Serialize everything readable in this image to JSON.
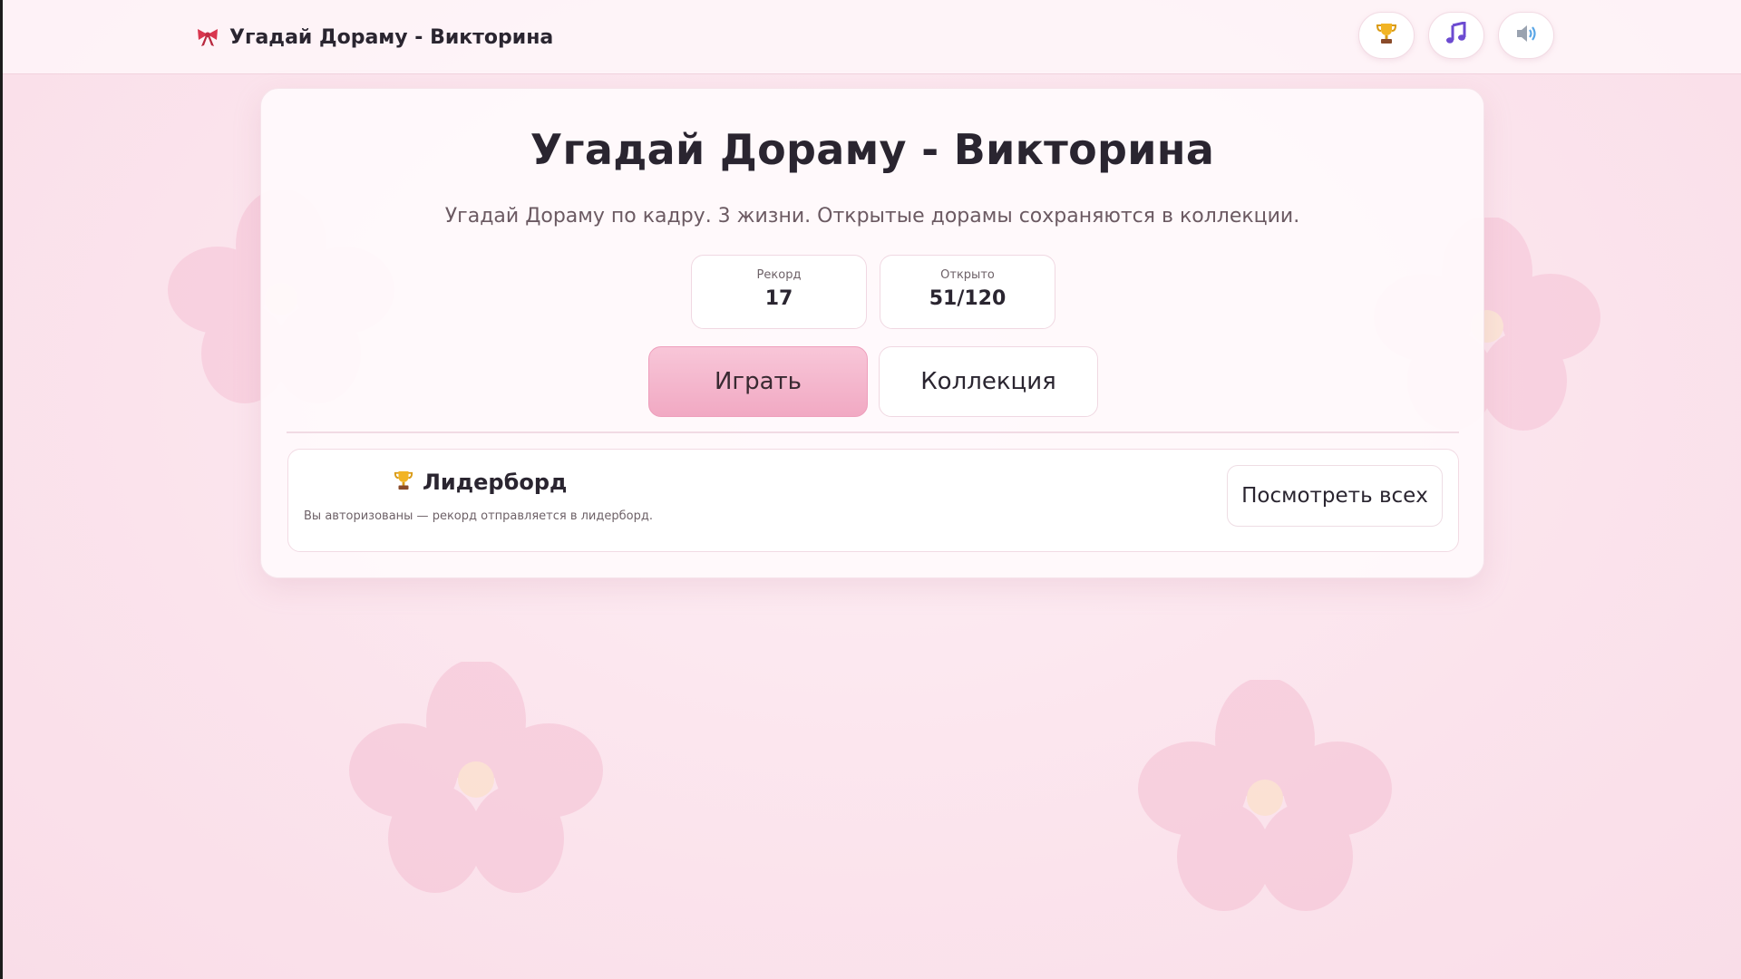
{
  "header": {
    "brand_title": "Угадай Дораму - Викторина",
    "icons": [
      "bow-icon",
      "trophy-icon",
      "music-note-icon",
      "speaker-icon"
    ]
  },
  "main": {
    "title": "Угадай Дораму - Викторина",
    "subtitle": "Угадай Дораму по кадру. 3 жизни. Открытые дорамы сохраняются в коллекции.",
    "stats": [
      {
        "label": "Рекорд",
        "value": "17"
      },
      {
        "label": "Открыто",
        "value": "51/120"
      }
    ],
    "buttons": {
      "play": "Играть",
      "collection": "Коллекция"
    },
    "leaderboard": {
      "title": "Лидерборд",
      "note": "Вы авторизованы — рекорд отправляется в лидерборд.",
      "view_all": "Посмотреть всех"
    }
  },
  "colors": {
    "background": "#fbe3ec",
    "accent_pink": "#f1a9c3",
    "text_dark": "#2a2530",
    "border": "#f0d8e2"
  }
}
